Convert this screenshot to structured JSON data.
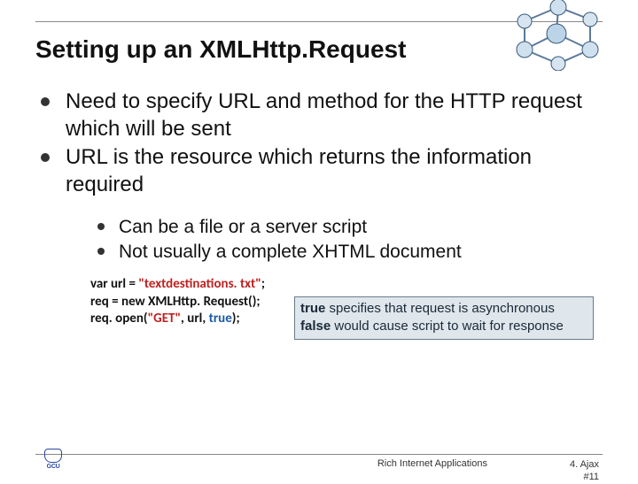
{
  "title": "Setting up an XMLHttp.Request",
  "bullets_l1": {
    "b1": "Need to specify URL and method for the HTTP request which will be sent",
    "b2": "URL is the resource which returns the information required"
  },
  "bullets_l2": {
    "b1": "Can be a file or a server script",
    "b2": "Not usually a complete XHTML document"
  },
  "code": {
    "l1_a": "var url = ",
    "l1_b": "\"textdestinations. txt\"",
    "l1_c": ";",
    "l2": "req = new XMLHttp. Request();",
    "l3_a": "req. open(",
    "l3_b": "\"GET\"",
    "l3_c": ", url,  ",
    "l3_d": "true",
    "l3_e": ");"
  },
  "note": {
    "t1b": "true",
    "t1": " specifies that request is asynchronous",
    "t2b": "false",
    "t2": " would cause script to wait for response"
  },
  "footer": {
    "course": "Rich Internet Applications",
    "chapter": "4. Ajax",
    "slide": "#11"
  },
  "logo_text": "GCU"
}
